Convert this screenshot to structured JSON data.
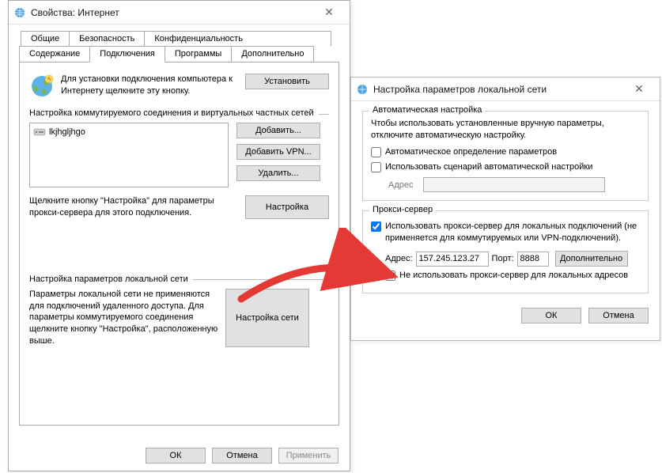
{
  "dialog1": {
    "title": "Свойства: Интернет",
    "tabs": {
      "row1": [
        "Общие",
        "Безопасность",
        "Конфиденциальность"
      ],
      "row2": [
        "Содержание",
        "Подключения",
        "Программы",
        "Дополнительно"
      ],
      "active_index": 1
    },
    "setup_text": "Для установки подключения компьютера к Интернету щелкните эту кнопку.",
    "install_btn": "Установить",
    "dialup_label": "Настройка коммутируемого соединения и виртуальных частных сетей",
    "list_item": "lkjhgljhgo",
    "add_btn": "Добавить...",
    "add_vpn_btn": "Добавить VPN...",
    "delete_btn": "Удалить...",
    "note_text": "Щелкните кнопку \"Настройка\" для параметры прокси-сервера для этого подключения.",
    "settings_btn": "Настройка",
    "lan_label": "Настройка параметров локальной сети",
    "lan_text": "Параметры локальной сети не применяются для подключений удаленного доступа. Для параметры коммутируемого соединения щелкните кнопку \"Настройка\", расположенную выше.",
    "lan_btn": "Настройка сети",
    "ok": "ОК",
    "cancel": "Отмена",
    "apply": "Применить"
  },
  "dialog2": {
    "title": "Настройка параметров локальной сети",
    "auto_legend": "Автоматическая настройка",
    "auto_text": "Чтобы использовать установленные вручную параметры, отключите автоматическую настройку.",
    "auto_detect": "Автоматическое определение параметров",
    "use_script": "Использовать сценарий автоматической настройки",
    "addr_label": "Адрес",
    "proxy_legend": "Прокси-сервер",
    "use_proxy": "Использовать прокси-сервер для локальных подключений (не применяется для коммутируемых или VPN-подключений).",
    "p_addr_label": "Адрес:",
    "p_addr_val": "157.245.123.27",
    "p_port_label": "Порт:",
    "p_port_val": "8888",
    "advanced_btn": "Дополнительно",
    "bypass_local": "Не использовать прокси-сервер для локальных адресов",
    "ok": "ОК",
    "cancel": "Отмена"
  }
}
